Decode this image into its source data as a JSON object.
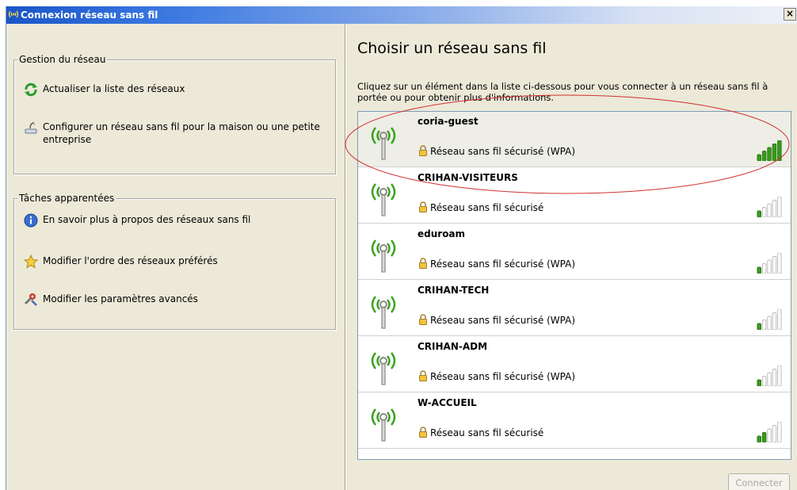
{
  "window": {
    "title": "Connexion réseau sans fil",
    "close_label": "×"
  },
  "left": {
    "network_group": {
      "title": "Gestion du réseau",
      "tasks": [
        {
          "label": "Actualiser la liste des réseaux",
          "icon": "refresh-icon"
        },
        {
          "label": "Configurer un réseau sans fil pour la maison ou une petite entreprise",
          "icon": "wizard-icon"
        }
      ]
    },
    "related_group": {
      "title": "Tâches apparentées",
      "tasks": [
        {
          "label": "En savoir plus à propos des réseaux sans fil",
          "icon": "info-icon"
        },
        {
          "label": "Modifier l'ordre des réseaux préférés",
          "icon": "star-icon"
        },
        {
          "label": "Modifier les paramètres avancés",
          "icon": "settings-icon"
        }
      ]
    }
  },
  "main": {
    "heading": "Choisir un réseau sans fil",
    "description": "Cliquez sur un élément dans la liste ci-dessous pour vous connecter à un réseau sans fil à portée ou pour obtenir plus d'informations.",
    "networks": [
      {
        "name": "coria-guest",
        "security": "Réseau sans fil sécurisé (WPA)",
        "signal": 5,
        "selected": true
      },
      {
        "name": "CRIHAN-VISITEURS",
        "security": "Réseau sans fil sécurisé",
        "signal": 1,
        "selected": false
      },
      {
        "name": "eduroam",
        "security": "Réseau sans fil sécurisé (WPA)",
        "signal": 1,
        "selected": false
      },
      {
        "name": "CRIHAN-TECH",
        "security": "Réseau sans fil sécurisé (WPA)",
        "signal": 1,
        "selected": false
      },
      {
        "name": "CRIHAN-ADM",
        "security": "Réseau sans fil sécurisé (WPA)",
        "signal": 1,
        "selected": false
      },
      {
        "name": "W-ACCUEIL",
        "security": "Réseau sans fil sécurisé",
        "signal": 2,
        "selected": false
      }
    ],
    "connect_label": "Connecter"
  },
  "colors": {
    "signal_on": "#3a9a1e",
    "signal_off": "#bcbcbc",
    "annotation": "#d03030",
    "title_bar": "#1a55c8"
  }
}
